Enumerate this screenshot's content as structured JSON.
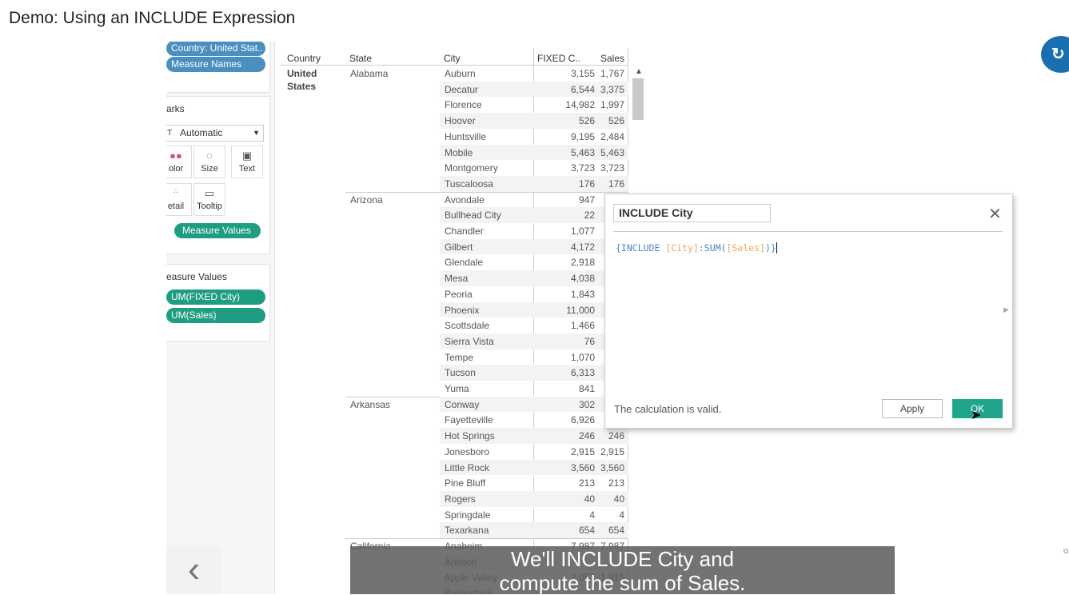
{
  "title": "Demo: Using an INCLUDE Expression",
  "filters": {
    "country_pill": "Country: United Stat..",
    "measure_names_pill": "Measure Names"
  },
  "marks": {
    "label": "arks",
    "type": "Automatic",
    "buttons": [
      "olor",
      "Size",
      "Text",
      "etail",
      "Tooltip"
    ],
    "text_pill": "Measure Values"
  },
  "measure_values": {
    "label": "easure Values",
    "pills": [
      "UM(FIXED City)",
      "UM(Sales)"
    ]
  },
  "table": {
    "headers": [
      "Country",
      "State",
      "City",
      "FIXED C..",
      "Sales"
    ],
    "country": "United States",
    "states": [
      {
        "name": "Alabama",
        "rows": [
          [
            "Auburn",
            "3,155",
            "1,767"
          ],
          [
            "Decatur",
            "6,544",
            "3,375"
          ],
          [
            "Florence",
            "14,982",
            "1,997"
          ],
          [
            "Hoover",
            "526",
            "526"
          ],
          [
            "Huntsville",
            "9,195",
            "2,484"
          ],
          [
            "Mobile",
            "5,463",
            "5,463"
          ],
          [
            "Montgomery",
            "3,723",
            "3,723"
          ],
          [
            "Tuscaloosa",
            "176",
            "176"
          ]
        ]
      },
      {
        "name": "Arizona",
        "rows": [
          [
            "Avondale",
            "947",
            ""
          ],
          [
            "Bullhead City",
            "22",
            ""
          ],
          [
            "Chandler",
            "1,077",
            ""
          ],
          [
            "Gilbert",
            "4,172",
            ""
          ],
          [
            "Glendale",
            "2,918",
            ""
          ],
          [
            "Mesa",
            "4,038",
            ""
          ],
          [
            "Peoria",
            "1,843",
            ""
          ],
          [
            "Phoenix",
            "11,000",
            ""
          ],
          [
            "Scottsdale",
            "1,466",
            ""
          ],
          [
            "Sierra Vista",
            "76",
            ""
          ],
          [
            "Tempe",
            "1,070",
            ""
          ],
          [
            "Tucson",
            "6,313",
            ""
          ],
          [
            "Yuma",
            "841",
            ""
          ]
        ]
      },
      {
        "name": "Arkansas",
        "rows": [
          [
            "Conway",
            "302",
            ""
          ],
          [
            "Fayetteville",
            "6,926",
            ""
          ],
          [
            "Hot Springs",
            "246",
            "246"
          ],
          [
            "Jonesboro",
            "2,915",
            "2,915"
          ],
          [
            "Little Rock",
            "3,560",
            "3,560"
          ],
          [
            "Pine Bluff",
            "213",
            "213"
          ],
          [
            "Rogers",
            "40",
            "40"
          ],
          [
            "Springdale",
            "4",
            "4"
          ],
          [
            "Texarkana",
            "654",
            "654"
          ]
        ]
      },
      {
        "name": "California",
        "rows": [
          [
            "Anaheim",
            "7,987",
            "7,987"
          ],
          [
            "Antioch",
            "",
            ""
          ],
          [
            "Apple Valley",
            "2,053",
            "1,915"
          ],
          [
            "Bakersfield",
            "",
            ""
          ]
        ]
      }
    ]
  },
  "dialog": {
    "name": "INCLUDE City",
    "formula": {
      "open": "{INCLUDE ",
      "field1": "[City]",
      "mid": ":SUM(",
      "field2": "[Sales]",
      "close": ")}"
    },
    "status": "The calculation is valid.",
    "apply": "Apply",
    "ok": "OK"
  },
  "caption": {
    "line1": "We'll INCLUDE City and",
    "line2": "compute the sum of Sales."
  },
  "colors": {
    "blue_pill": "#4a8fbf",
    "green_pill": "#1f9d82",
    "ok_button": "#1fa58a",
    "formula_keyword": "#4a86c5",
    "formula_field": "#f0a35e"
  }
}
